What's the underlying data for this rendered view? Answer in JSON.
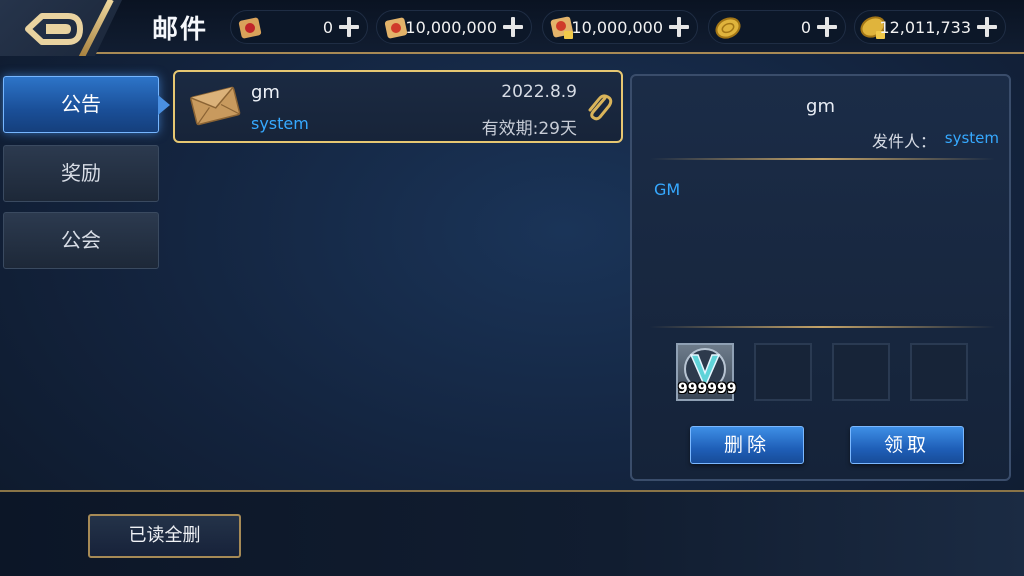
{
  "header": {
    "title": "邮件",
    "resources": [
      {
        "icon": "scroll-red-icon",
        "value": "0"
      },
      {
        "icon": "scroll-gold-icon",
        "value": "10,000,000"
      },
      {
        "icon": "scroll-locked-icon",
        "value": "10,000,000"
      },
      {
        "icon": "gold-coin-icon",
        "value": "0"
      },
      {
        "icon": "gold-coin-locked-icon",
        "value": "12,011,733"
      }
    ]
  },
  "tabs": [
    {
      "label": "公告",
      "active": true
    },
    {
      "label": "奖励",
      "active": false
    },
    {
      "label": "公会",
      "active": false
    }
  ],
  "mail_list": [
    {
      "subject": "gm",
      "sender": "system",
      "date": "2022.8.9",
      "expiry": "有效期:29天",
      "has_attachment": true
    }
  ],
  "detail": {
    "subject": "gm",
    "from_label": "发件人：",
    "from": "system",
    "body": "GM",
    "attachments": [
      {
        "icon": "v-badge-icon",
        "quantity": "999999"
      },
      {
        "icon": "",
        "quantity": ""
      },
      {
        "icon": "",
        "quantity": ""
      },
      {
        "icon": "",
        "quantity": ""
      }
    ],
    "delete_label": "删除",
    "claim_label": "领取"
  },
  "footer": {
    "delete_all_read_label": "已读全删"
  },
  "colors": {
    "accent_blue": "#36a9ff",
    "gold_border": "#e6c772",
    "active_tab": "#2d74c8"
  }
}
